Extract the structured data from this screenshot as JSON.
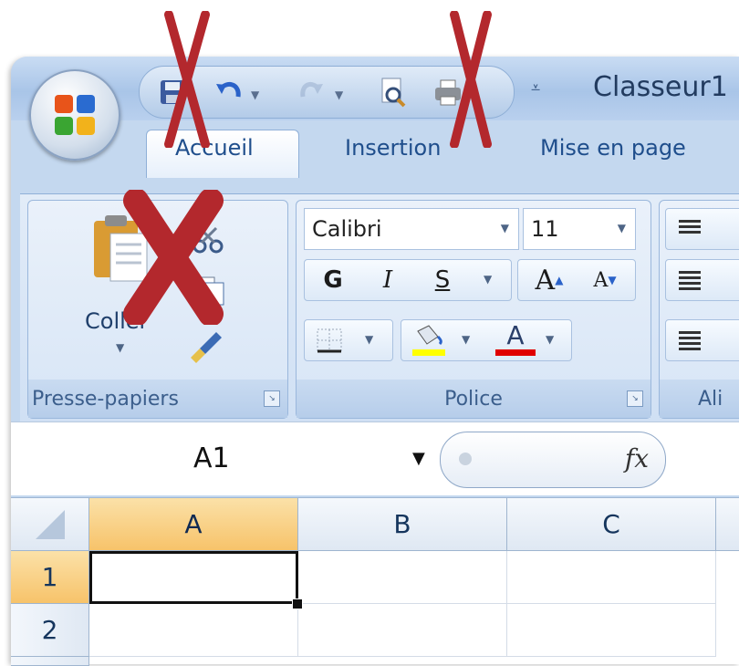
{
  "window": {
    "title": "Classeur1"
  },
  "quick_access": {
    "items": [
      {
        "name": "save",
        "icon": "save-icon"
      },
      {
        "name": "undo",
        "icon": "undo-icon"
      },
      {
        "name": "redo",
        "icon": "redo-icon"
      },
      {
        "name": "print-preview",
        "icon": "print-preview-icon"
      },
      {
        "name": "print",
        "icon": "print-icon"
      }
    ],
    "customize_icon": "customize-qat-icon"
  },
  "tabs": [
    {
      "label": "Accueil",
      "active": true
    },
    {
      "label": "Insertion",
      "active": false
    },
    {
      "label": "Mise en page",
      "active": false
    }
  ],
  "ribbon": {
    "clipboard": {
      "paste_label": "Coller",
      "group_label": "Presse-papiers"
    },
    "font": {
      "font_name": "Calibri",
      "font_size": "11",
      "bold": "G",
      "italic": "I",
      "underline": "S",
      "grow": "A",
      "shrink": "A",
      "font_color_letter": "A",
      "group_label": "Police",
      "highlight_color": "#ffff00",
      "font_color": "#e00000"
    },
    "alignment": {
      "group_label_partial": "Ali"
    }
  },
  "formula_bar": {
    "name_box": "A1",
    "fx_label": "fx"
  },
  "sheet": {
    "columns": [
      "A",
      "B",
      "C"
    ],
    "rows": [
      "1",
      "2"
    ],
    "selected_cell": "A1"
  },
  "annotations": {
    "cross_color": "#b3282d"
  }
}
